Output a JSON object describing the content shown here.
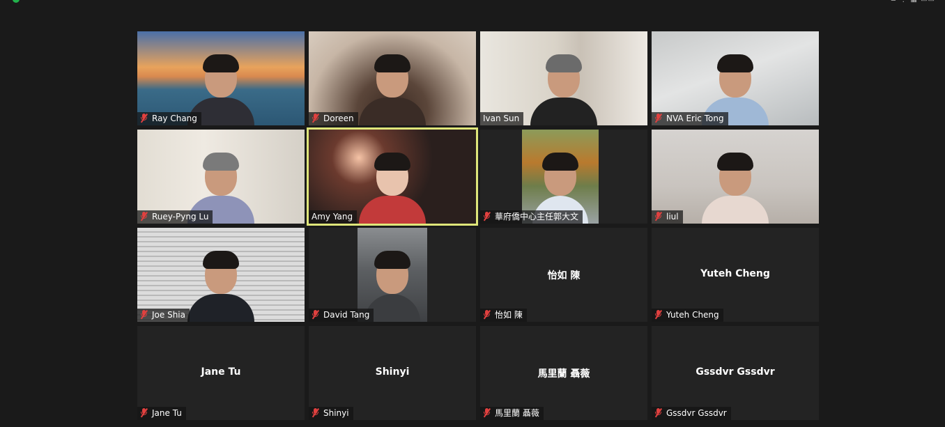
{
  "window": {
    "top_right_text": "≡ ⋮ ▦ ▭▭"
  },
  "participants": [
    {
      "name": "Ray Chang",
      "muted": true,
      "video": true,
      "active": false
    },
    {
      "name": "Doreen",
      "muted": true,
      "video": true,
      "active": false
    },
    {
      "name": "Ivan Sun",
      "muted": false,
      "video": true,
      "active": false
    },
    {
      "name": "NVA Eric Tong",
      "muted": true,
      "video": true,
      "active": false
    },
    {
      "name": "Ruey-Pyng Lu",
      "muted": true,
      "video": true,
      "active": false
    },
    {
      "name": "Amy Yang",
      "muted": false,
      "video": true,
      "active": true
    },
    {
      "name": "華府僑中心主任郭大文",
      "muted": true,
      "video": true,
      "active": false
    },
    {
      "name": "liul",
      "muted": true,
      "video": true,
      "active": false
    },
    {
      "name": "Joe Shia",
      "muted": true,
      "video": true,
      "active": false
    },
    {
      "name": "David Tang",
      "muted": true,
      "video": true,
      "active": false
    },
    {
      "name": "怡如 陳",
      "muted": true,
      "video": false,
      "active": false
    },
    {
      "name": "Yuteh Cheng",
      "muted": true,
      "video": false,
      "active": false
    },
    {
      "name": "Jane Tu",
      "muted": true,
      "video": false,
      "active": false
    },
    {
      "name": "Shinyi",
      "muted": true,
      "video": false,
      "active": false
    },
    {
      "name": "馬里蘭 聶薇",
      "muted": true,
      "video": false,
      "active": false
    },
    {
      "name": "Gssdvr Gssdvr",
      "muted": true,
      "video": false,
      "active": false
    }
  ],
  "colors": {
    "background": "#1a1a1a",
    "tile_background": "#232323",
    "active_speaker_border": "#dfe67a",
    "muted_icon": "#e0403f"
  },
  "icons": {
    "muted": "mic-muted-icon"
  }
}
